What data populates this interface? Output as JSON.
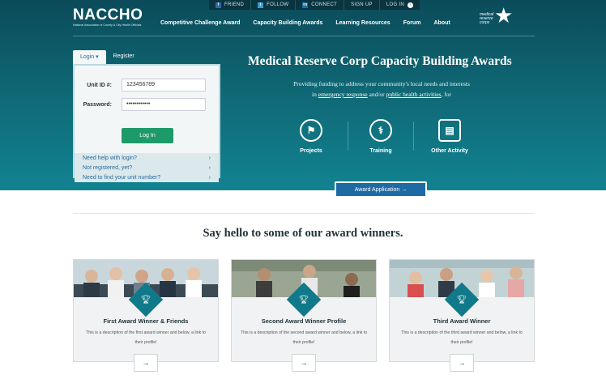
{
  "topbar": {
    "items": [
      {
        "icon": "f",
        "label": "FRIEND"
      },
      {
        "icon": "t",
        "label": "FOLLOW"
      },
      {
        "icon": "in",
        "label": "CONNECT"
      },
      {
        "icon": "",
        "label": "SIGN UP"
      },
      {
        "icon": "",
        "label": "LOG IN"
      }
    ]
  },
  "logo": {
    "name": "NACCHO",
    "subtitle": "National Association of County & City Health Officials"
  },
  "nav": [
    "Competitive Challenge Award",
    "Capacity Building Awards",
    "Learning Resources",
    "Forum",
    "About"
  ],
  "mrc_logo": {
    "text": "medical reserve corps"
  },
  "login": {
    "tab_login": "Login ▾",
    "tab_register": "Register",
    "unit_label": "Unit ID #:",
    "unit_value": "123456789",
    "password_label": "Password:",
    "password_value": "••••••••••••",
    "button": "Log In",
    "help": [
      "Need help with login?",
      "Not registered, yet?",
      "Need to find your unit number?"
    ]
  },
  "hero": {
    "title": "Medical Reserve Corp Capacity Building Awards",
    "sub_line1": "Providing funding to address your community's local needs and interests",
    "sub_in": "in",
    "link1": "emergency response",
    "sub_and": "and/or",
    "link2": "public health activities",
    "sub_end": ", for",
    "features": [
      "Projects",
      "Training",
      "Other Activity"
    ],
    "award_button": "Award Application →"
  },
  "winners": {
    "heading": "Say hello to some of our award winners.",
    "cards": [
      {
        "title": "First Award Winner & Friends",
        "desc": "This is a description of the first award winner and below, a link to their profile!"
      },
      {
        "title": "Second Award Winner Profile",
        "desc": "This is a description of the second award winner and below, a link to their profile!"
      },
      {
        "title": "Third Award Winner",
        "desc": "This is a description of the third award winner and below, a link to their profile!"
      }
    ]
  },
  "colors": {
    "teal_dark": "#0b4b5a",
    "teal": "#128391",
    "accent_green": "#1e9a6a",
    "accent_blue": "#1e6aa5"
  }
}
